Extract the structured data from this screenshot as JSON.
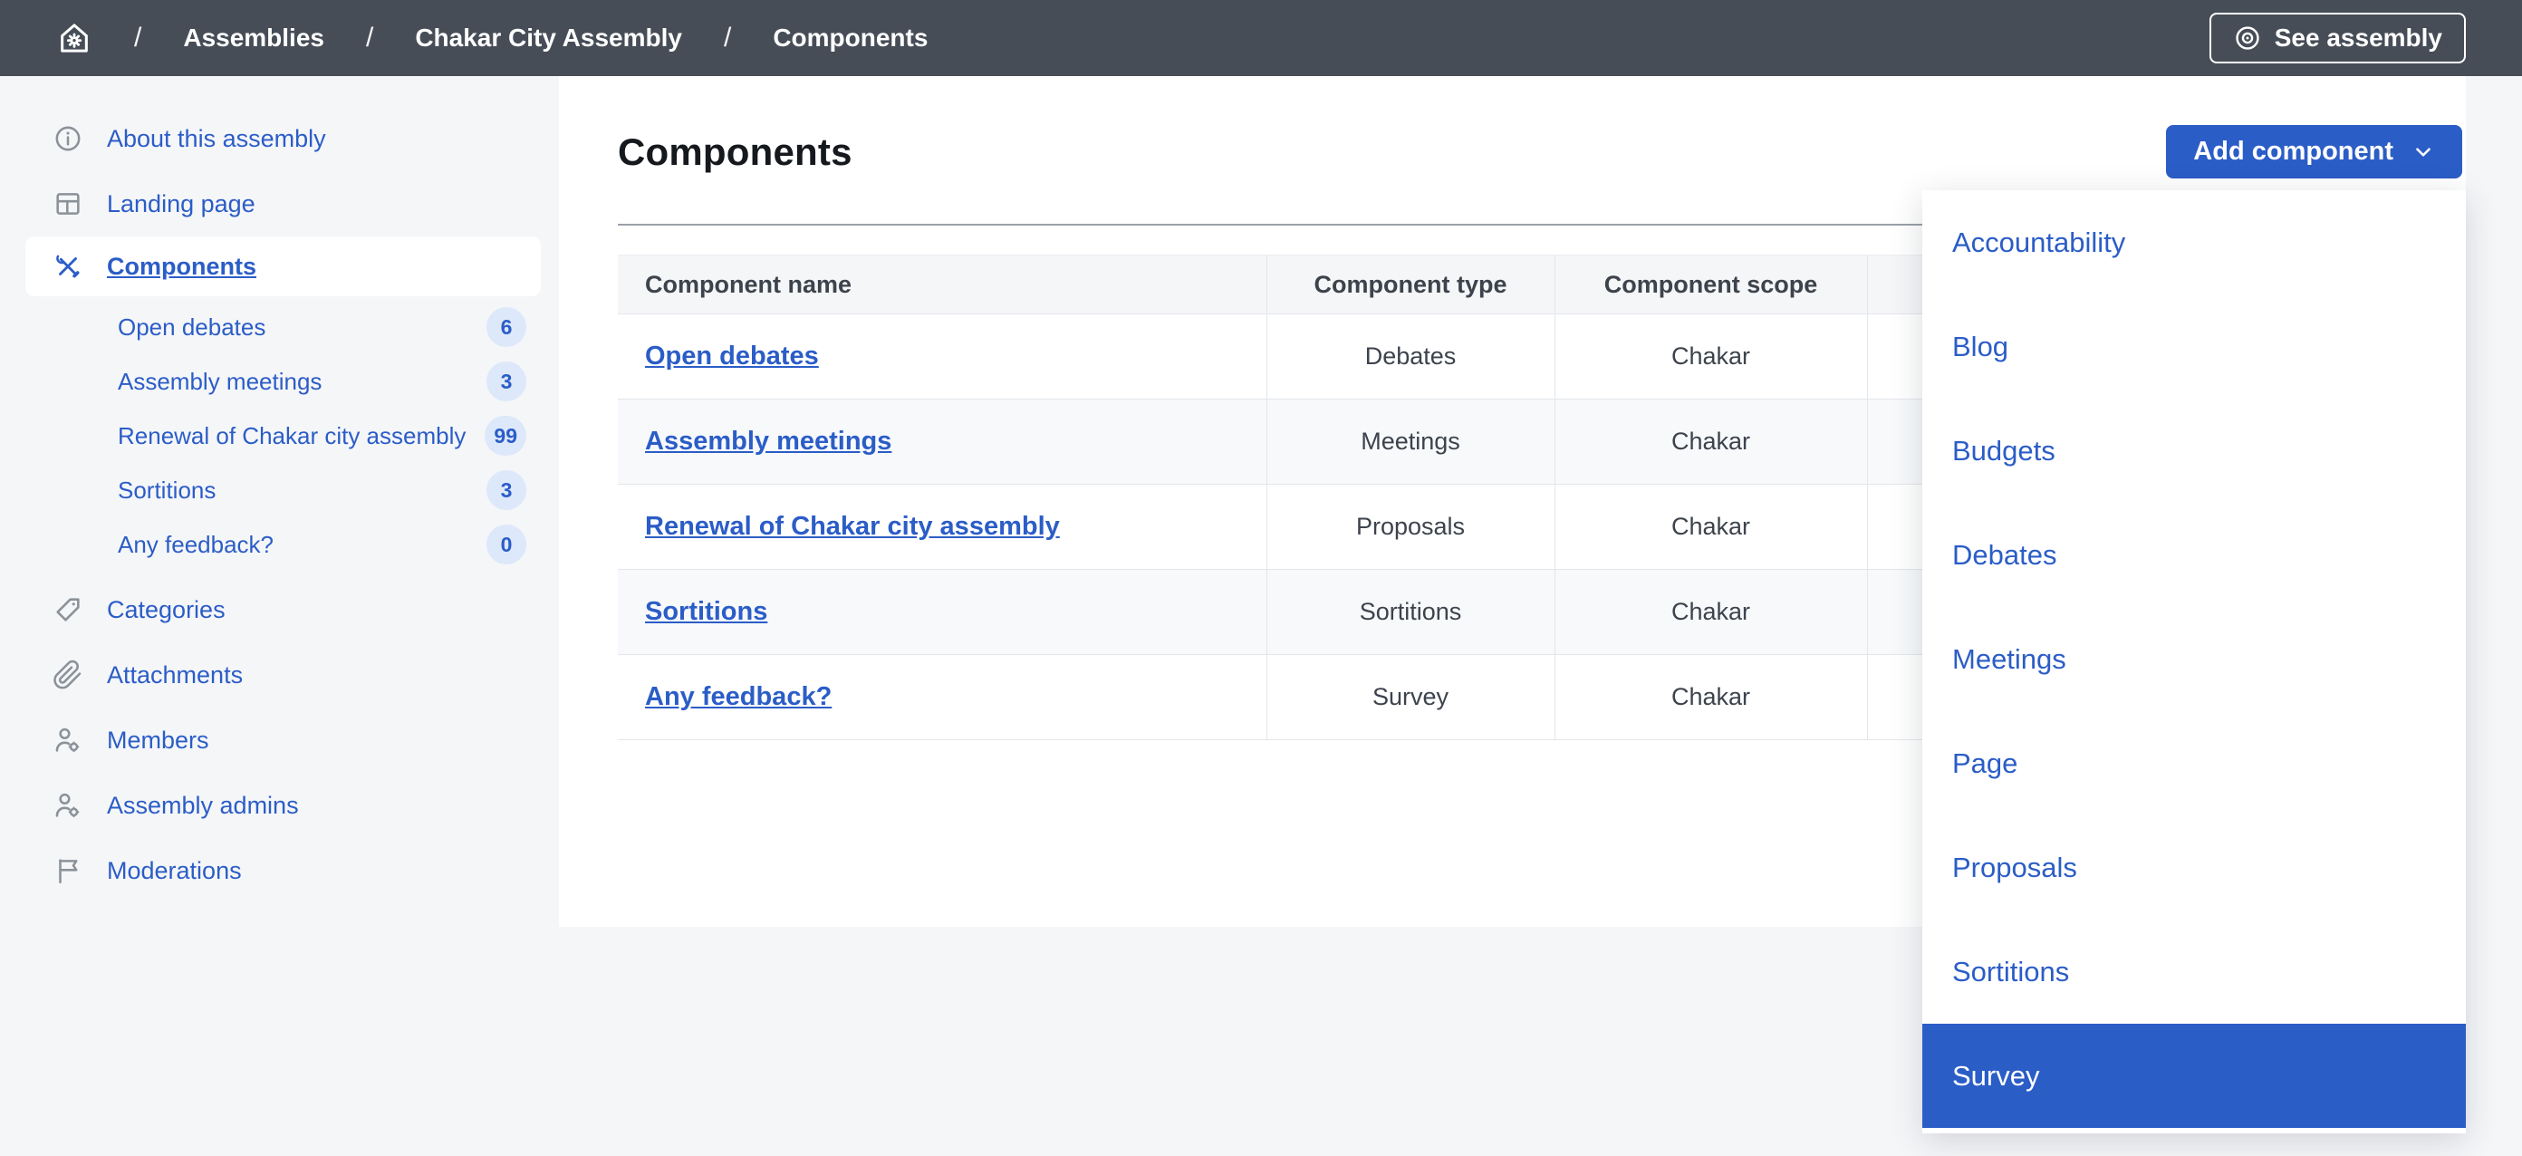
{
  "colors": {
    "accent": "#2b5dc7",
    "topbar_bg": "#464d57",
    "page_bg": "#f5f6f8",
    "content_bg": "#ffffff",
    "badge_bg": "#dde8fa",
    "row_alt_bg": "#f7f9fb",
    "table_border": "#e3e6ea",
    "divider": "#9aa0a9",
    "icon_gray": "#8b9299",
    "text_dark": "#3d434c",
    "dropdown_active_bg": "#2b5dc7"
  },
  "topbar": {
    "home_icon": "home-gear-icon",
    "breadcrumb": {
      "separator": "/",
      "items": [
        {
          "label": "Assemblies"
        },
        {
          "label": "Chakar City Assembly"
        },
        {
          "label": "Components"
        }
      ]
    },
    "see_assembly": {
      "label": "See assembly",
      "icon": "eye-icon"
    }
  },
  "sidebar": {
    "items": [
      {
        "label": "About this assembly",
        "icon": "info-icon",
        "active": false
      },
      {
        "label": "Landing page",
        "icon": "layout-icon",
        "active": false
      },
      {
        "label": "Components",
        "icon": "tools-icon",
        "active": true
      },
      {
        "label": "Categories",
        "icon": "tag-icon",
        "active": false
      },
      {
        "label": "Attachments",
        "icon": "paperclip-icon",
        "active": false
      },
      {
        "label": "Members",
        "icon": "user-gear-icon",
        "active": false
      },
      {
        "label": "Assembly admins",
        "icon": "user-gear-icon",
        "active": false
      },
      {
        "label": "Moderations",
        "icon": "flag-icon",
        "active": false
      }
    ],
    "components_children": [
      {
        "label": "Open debates",
        "badge": "6"
      },
      {
        "label": "Assembly meetings",
        "badge": "3"
      },
      {
        "label": "Renewal of Chakar city assembly",
        "badge": "99"
      },
      {
        "label": "Sortitions",
        "badge": "3"
      },
      {
        "label": "Any feedback?",
        "badge": "0"
      }
    ]
  },
  "main": {
    "title": "Components",
    "add_component": {
      "label": "Add component",
      "icon": "chevron-down-icon"
    },
    "table": {
      "headers": [
        "Component name",
        "Component type",
        "Component scope"
      ],
      "rows": [
        {
          "name": "Open debates",
          "type": "Debates",
          "scope": "Chakar"
        },
        {
          "name": "Assembly meetings",
          "type": "Meetings",
          "scope": "Chakar"
        },
        {
          "name": "Renewal of Chakar city assembly",
          "type": "Proposals",
          "scope": "Chakar"
        },
        {
          "name": "Sortitions",
          "type": "Sortitions",
          "scope": "Chakar"
        },
        {
          "name": "Any feedback?",
          "type": "Survey",
          "scope": "Chakar"
        }
      ]
    }
  },
  "dropdown": {
    "items": [
      "Accountability",
      "Blog",
      "Budgets",
      "Debates",
      "Meetings",
      "Page",
      "Proposals",
      "Sortitions",
      "Survey"
    ],
    "active_item": "Survey"
  }
}
